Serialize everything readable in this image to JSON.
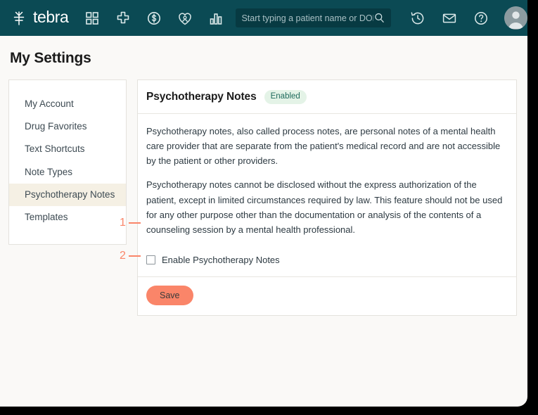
{
  "topbar": {
    "brand": "tebra",
    "brand_icon": "tebra-leaf-logo",
    "nav_icons": [
      {
        "name": "dashboard-grid-icon",
        "label": "Dashboard"
      },
      {
        "name": "medical-cross-icon",
        "label": "Clinical"
      },
      {
        "name": "dollar-circle-icon",
        "label": "Billing"
      },
      {
        "name": "heart-patient-icon",
        "label": "Patients"
      },
      {
        "name": "bar-chart-icon",
        "label": "Reports"
      }
    ],
    "search": {
      "placeholder": "Start typing a patient name or DOB",
      "value": "",
      "icon": "search-icon"
    },
    "right_icons": [
      {
        "name": "history-clock-icon",
        "label": "Recent"
      },
      {
        "name": "envelope-icon",
        "label": "Messages"
      },
      {
        "name": "help-question-icon",
        "label": "Help"
      }
    ],
    "avatar": {
      "name": "user-avatar",
      "label": "Account"
    }
  },
  "page": {
    "title": "My Settings"
  },
  "sidebar": {
    "items": [
      {
        "label": "My Account",
        "active": false
      },
      {
        "label": "Drug Favorites",
        "active": false
      },
      {
        "label": "Text Shortcuts",
        "active": false
      },
      {
        "label": "Note Types",
        "active": false
      },
      {
        "label": "Psychotherapy Notes",
        "active": true
      },
      {
        "label": "Templates",
        "active": false
      }
    ]
  },
  "card": {
    "title": "Psychotherapy Notes",
    "status_badge": "Enabled",
    "paragraphs": [
      "Psychotherapy notes, also called process notes, are personal notes of a mental health care provider that are separate from the patient's medical record and are not accessible by the patient or other providers.",
      "Psychotherapy notes cannot be disclosed without the express authorization of the patient, except in limited circumstances required by law. This feature should not be used for any other purpose other than the documentation or analysis of the contents of a counseling session by a mental health professional."
    ],
    "checkbox": {
      "label": "Enable Psychotherapy Notes",
      "checked": false
    },
    "save_label": "Save"
  },
  "callouts": [
    {
      "number": "1"
    },
    {
      "number": "2"
    }
  ],
  "colors": {
    "topbar": "#0B4A54",
    "page_background": "#FAF9F7",
    "accent_coral": "#FA8569",
    "sidebar_active": "#F5F0E4",
    "badge_background": "#E4F3E7",
    "badge_text": "#1F6B5C"
  }
}
